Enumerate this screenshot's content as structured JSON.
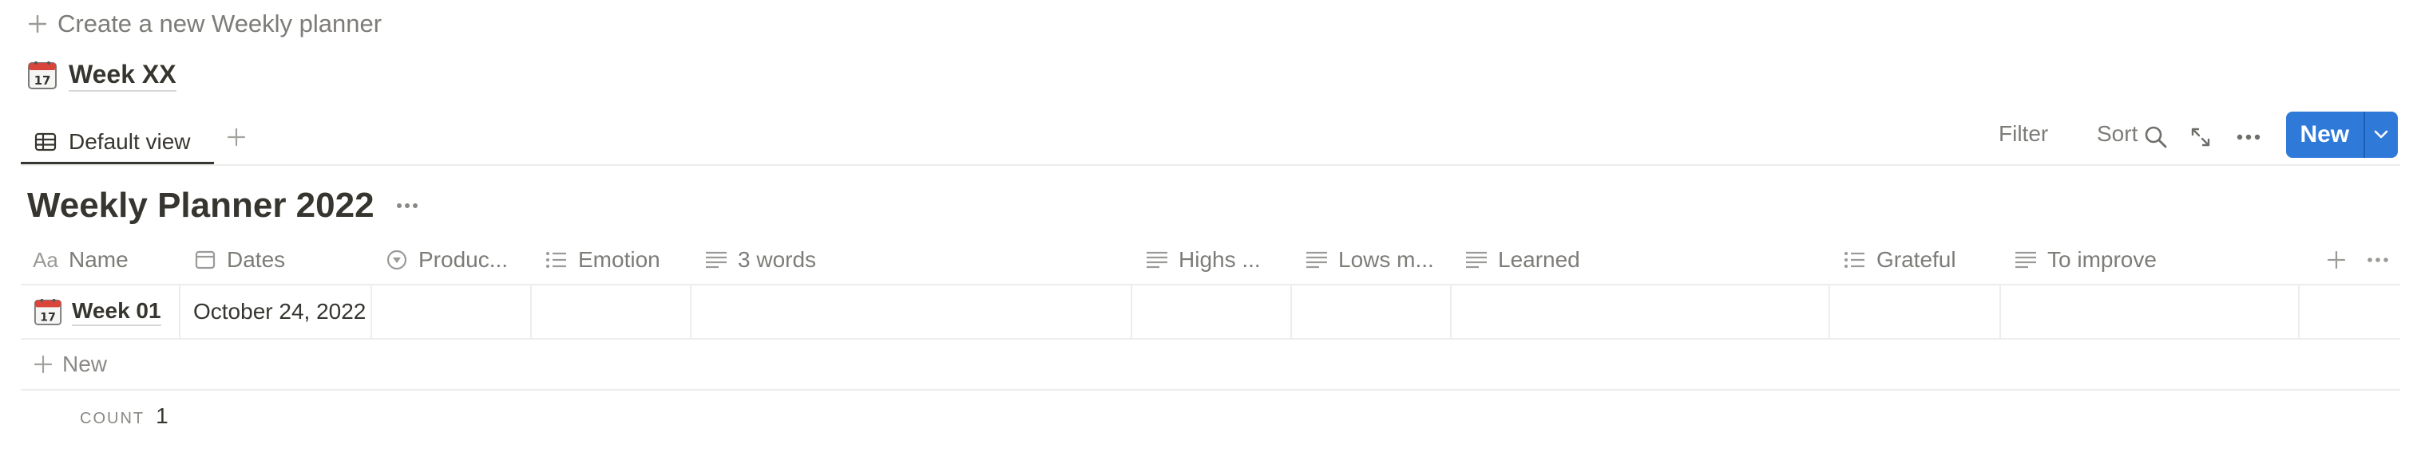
{
  "create_row": {
    "label": "Create a new Weekly planner"
  },
  "template": {
    "title": "Week XX",
    "icon": "calendar-icon"
  },
  "views": {
    "active_tab": "Default view"
  },
  "toolbar": {
    "filter": "Filter",
    "sort": "Sort",
    "new": "New"
  },
  "database": {
    "title": "Weekly Planner 2022"
  },
  "columns": [
    {
      "label": "Name",
      "icon": "aa-title-icon"
    },
    {
      "label": "Dates",
      "icon": "calendar-prop-icon"
    },
    {
      "label": "Produc...",
      "icon": "select-circle-icon"
    },
    {
      "label": "Emotion",
      "icon": "list-icon"
    },
    {
      "label": "3 words",
      "icon": "text-icon"
    },
    {
      "label": "Highs ...",
      "icon": "text-icon"
    },
    {
      "label": "Lows m...",
      "icon": "text-icon"
    },
    {
      "label": "Learned",
      "icon": "text-icon"
    },
    {
      "label": "Grateful",
      "icon": "list-icon"
    },
    {
      "label": "To improve",
      "icon": "text-icon"
    }
  ],
  "rows": [
    {
      "name": "Week 01",
      "dates": "October 24, 2022"
    }
  ],
  "new_row_label": "New",
  "footer": {
    "count_label": "COUNT",
    "count_value": "1"
  },
  "colors": {
    "accent": "#2f79d8",
    "text": "#37352f",
    "muted": "#8a8985",
    "divider": "#ededec"
  }
}
